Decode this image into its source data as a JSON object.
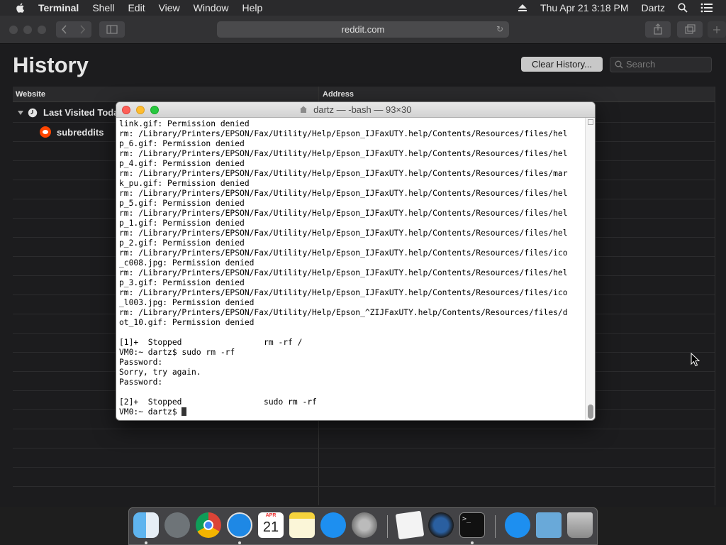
{
  "menubar": {
    "app_name": "Terminal",
    "items": [
      "Shell",
      "Edit",
      "View",
      "Window",
      "Help"
    ],
    "datetime": "Thu Apr 21  3:18 PM",
    "user": "Dartz"
  },
  "safari": {
    "address": "reddit.com",
    "page_title": "History",
    "clear_button": "Clear History...",
    "search_placeholder": "Search",
    "columns": {
      "website": "Website",
      "address": "Address"
    },
    "group_label": "Last Visited Today",
    "item_label": "subreddits"
  },
  "terminal": {
    "title": "dartz — -bash — 93×30",
    "lines": [
      "link.gif: Permission denied",
      "rm: /Library/Printers/EPSON/Fax/Utility/Help/Epson_IJFaxUTY.help/Contents/Resources/files/hel",
      "p_6.gif: Permission denied",
      "rm: /Library/Printers/EPSON/Fax/Utility/Help/Epson_IJFaxUTY.help/Contents/Resources/files/hel",
      "p_4.gif: Permission denied",
      "rm: /Library/Printers/EPSON/Fax/Utility/Help/Epson_IJFaxUTY.help/Contents/Resources/files/mar",
      "k_pu.gif: Permission denied",
      "rm: /Library/Printers/EPSON/Fax/Utility/Help/Epson_IJFaxUTY.help/Contents/Resources/files/hel",
      "p_5.gif: Permission denied",
      "rm: /Library/Printers/EPSON/Fax/Utility/Help/Epson_IJFaxUTY.help/Contents/Resources/files/hel",
      "p_1.gif: Permission denied",
      "rm: /Library/Printers/EPSON/Fax/Utility/Help/Epson_IJFaxUTY.help/Contents/Resources/files/hel",
      "p_2.gif: Permission denied",
      "rm: /Library/Printers/EPSON/Fax/Utility/Help/Epson_IJFaxUTY.help/Contents/Resources/files/ico",
      "_c008.jpg: Permission denied",
      "rm: /Library/Printers/EPSON/Fax/Utility/Help/Epson_IJFaxUTY.help/Contents/Resources/files/hel",
      "p_3.gif: Permission denied",
      "rm: /Library/Printers/EPSON/Fax/Utility/Help/Epson_IJFaxUTY.help/Contents/Resources/files/ico",
      "_l003.jpg: Permission denied",
      "rm: /Library/Printers/EPSON/Fax/Utility/Help/Epson_^ZIJFaxUTY.help/Contents/Resources/files/d",
      "ot_10.gif: Permission denied",
      "",
      "[1]+  Stopped                 rm -rf /",
      "VM0:~ dartz$ sudo rm -rf",
      "Password:",
      "Sorry, try again.",
      "Password:",
      "",
      "[2]+  Stopped                 sudo rm -rf"
    ],
    "prompt": "VM0:~ dartz$ "
  },
  "dock": {
    "apps": [
      "finder-icon",
      "launchpad-icon",
      "chrome-icon",
      "safari-icon",
      "calendar-icon",
      "notes-icon",
      "app-store-icon",
      "system-preferences-icon",
      "textedit-icon",
      "quicktime-icon",
      "terminal-icon",
      "app-store-2-icon",
      "downloads-folder-icon",
      "trash-icon"
    ],
    "calendar_month": "APR",
    "calendar_day": "21",
    "terminal_prompt": ">_"
  }
}
